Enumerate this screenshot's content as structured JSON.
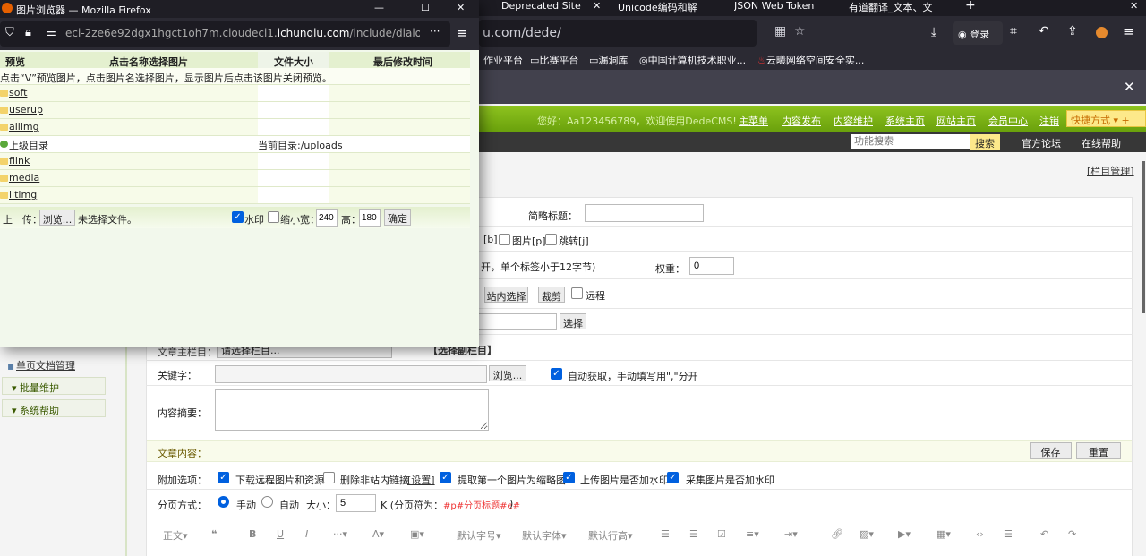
{
  "main_window": {
    "tabs": [
      {
        "label": "Deprecated Site"
      },
      {
        "label": "Unicode编码和解"
      },
      {
        "label": "JSON Web Token"
      },
      {
        "label": "有道翻译_文本、文"
      }
    ],
    "url_visible": "u.com/dede/",
    "login_label": "登录",
    "bookmarks": [
      "作业平台",
      "比赛平台",
      "漏洞库",
      "中国计算机技术职业...",
      "云曦网络空间安全实..."
    ]
  },
  "cms": {
    "welcome": "您好：Aa123456789，欢迎使用DedeCMS!",
    "nav": [
      "主菜单",
      "内容发布",
      "内容维护",
      "系统主页",
      "网站主页",
      "会员中心",
      "注销"
    ],
    "shortcut": "快捷方式",
    "search_placeholder": "功能搜索",
    "search_button": "搜索",
    "forum": "官方论坛",
    "help": "在线帮助",
    "column_manage": "[栏目管理]",
    "sidebar": {
      "single_page": "单页文档管理",
      "batch": "批量维护",
      "sys_help": "系统帮助"
    },
    "form": {
      "short_title": "简略标题：",
      "flags": [
        "[b]",
        "图片[p]",
        "跳转[j]"
      ],
      "tag_hint": "开，单个标签小于12字节)",
      "weight_label": "权重：",
      "weight_value": "0",
      "site_select": "站内选择",
      "crop": "裁剪",
      "remote": "远程",
      "select": "选择",
      "main_column": "文章主栏目：",
      "main_column_value": "请选择栏目...",
      "select_column": "【选择副栏目】",
      "keywords": "关键字：",
      "browse": "浏览...",
      "auto_fetch": "自动获取，手动填写用\",\"分开",
      "summary": "内容摘要：",
      "content": "文章内容：",
      "save": "保存",
      "reset": "重置",
      "extra_label": "附加选项：",
      "extras": [
        {
          "label": "下载远程图片和资源",
          "checked": true
        },
        {
          "label": "删除非站内链接",
          "checked": false
        },
        {
          "label": "提取第一个图片为缩略图",
          "checked": true
        },
        {
          "label": "上传图片是否加水印",
          "checked": true
        },
        {
          "label": "采集图片是否加水印",
          "checked": true
        }
      ],
      "settings_link": "[设置]",
      "paging_label": "分页方式：",
      "manual": "手动",
      "auto": "自动",
      "size_label": "大小：",
      "size_value": "5",
      "paging_hint_pre": "K (分页符为：",
      "paging_marker": "#p#分页标题#e#",
      "paging_hint_post": ")",
      "editor": [
        "正文",
        "默认字号",
        "默认字体",
        "默认行高"
      ]
    }
  },
  "popup": {
    "title": "图片浏览器 — Mozilla Firefox",
    "url_prefix": "eci-2ze6e92dgx1hgct1oh7m.cloudeci1.",
    "url_domain": "ichunqiu.com",
    "url_suffix": "/include/dialog/selec",
    "headers": [
      "预览",
      "点击名称选择图片",
      "文件大小",
      "最后修改时间"
    ],
    "notice": "点击“V”预览图片，点击图片名选择图片，显示图片后点击该图片关闭预览。",
    "rows": [
      {
        "name": "soft"
      },
      {
        "name": "userup"
      },
      {
        "name": "allimg"
      },
      {
        "name": "上级目录",
        "info": "当前目录:/uploads"
      },
      {
        "name": "flink"
      },
      {
        "name": "media"
      },
      {
        "name": "litimg"
      }
    ],
    "upload_label": "上　传：",
    "browse": "浏览...",
    "no_file": "未选择文件。",
    "watermark": "水印",
    "shrink": "缩小宽：",
    "width": "240",
    "height_label": "高：",
    "height": "180",
    "ok": "确定"
  }
}
